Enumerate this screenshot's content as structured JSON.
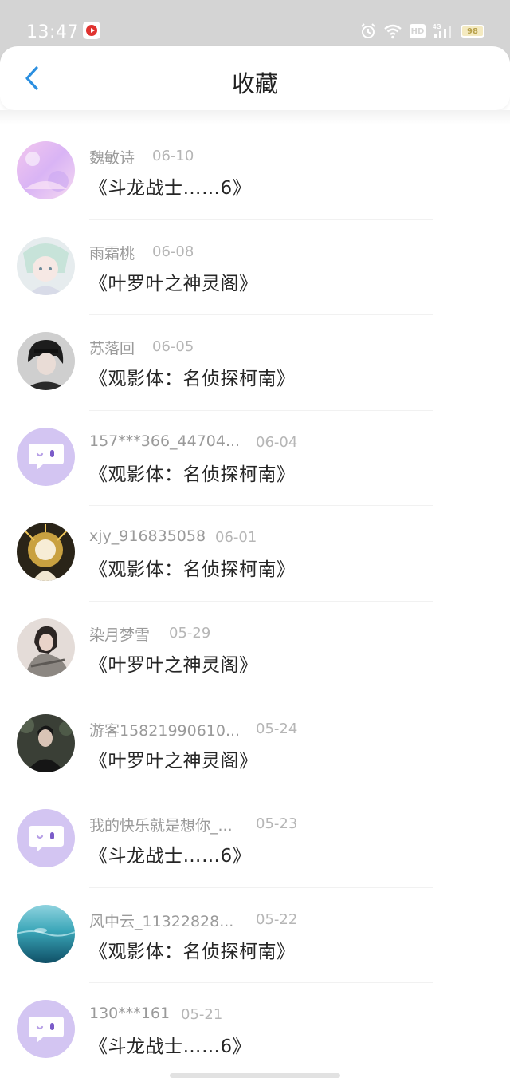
{
  "status_bar": {
    "time": "13:47",
    "battery": "98",
    "hd": "HD",
    "network": "4G"
  },
  "nav": {
    "title": "收藏"
  },
  "items": [
    {
      "name": "魏敏诗",
      "date": "06-10",
      "title": "《斗龙战士……6》",
      "avatar": "photo-pastel-pink"
    },
    {
      "name": "雨霜桃",
      "date": "06-08",
      "title": "《叶罗叶之神灵阁》",
      "avatar": "photo-anime-girl"
    },
    {
      "name": "苏落回",
      "date": "06-05",
      "title": "《观影体：名侦探柯南》",
      "avatar": "photo-dark-hair"
    },
    {
      "name": "157***366_44704...",
      "date": "06-04",
      "title": "《观影体：名侦探柯南》",
      "avatar": "default-chat-bubble"
    },
    {
      "name": "xjy_916835058",
      "date": "06-01",
      "title": "《观影体：名侦探柯南》",
      "avatar": "photo-golden-anime"
    },
    {
      "name": "染月梦雪",
      "date": "05-29",
      "title": "《叶罗叶之神灵阁》",
      "avatar": "photo-girl-scarf"
    },
    {
      "name": "游客15821990610...",
      "date": "05-24",
      "title": "《叶罗叶之神灵阁》",
      "avatar": "photo-man-black"
    },
    {
      "name": "我的快乐就是想你_...",
      "date": "05-23",
      "title": "《斗龙战士……6》",
      "avatar": "default-chat-bubble"
    },
    {
      "name": "风中云_11322828...",
      "date": "05-22",
      "title": "《观影体：名侦探柯南》",
      "avatar": "photo-ocean"
    },
    {
      "name": "130***161",
      "date": "05-21",
      "title": "《斗龙战士……6》",
      "avatar": "default-chat-bubble"
    }
  ],
  "colors": {
    "accent": "#2b8fe0",
    "default_avatar": "#d3c5f2"
  }
}
